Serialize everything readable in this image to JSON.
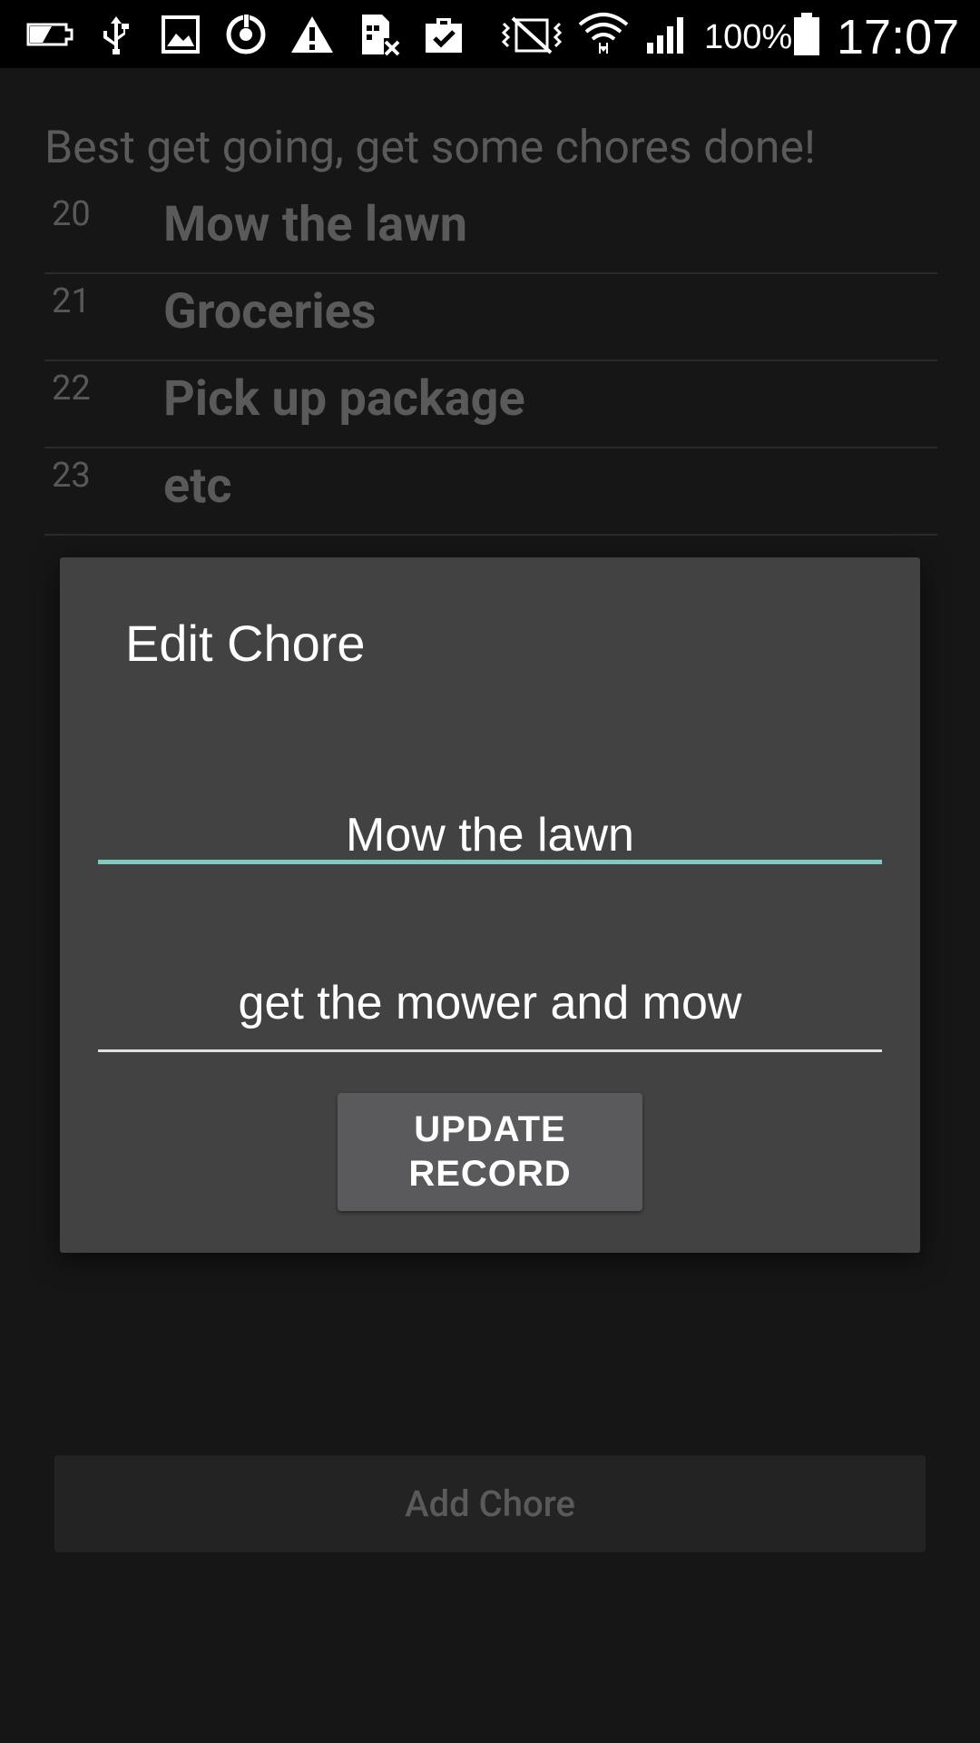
{
  "status_bar": {
    "icons": [
      "battery-low-icon",
      "usb-icon",
      "image-icon",
      "sync-icon",
      "warning-icon",
      "sim-error-icon",
      "clipboard-check-icon",
      "vibrate-icon",
      "wifi-icon",
      "signal-icon",
      "battery-icon"
    ],
    "battery_percent": "100%",
    "time": "17:07"
  },
  "main": {
    "heading": "Best get going, get some chores done!",
    "chores": [
      {
        "id": "20",
        "title": "Mow the lawn"
      },
      {
        "id": "21",
        "title": "Groceries"
      },
      {
        "id": "22",
        "title": "Pick up package"
      },
      {
        "id": "23",
        "title": "etc"
      }
    ],
    "add_button_label": "Add Chore"
  },
  "dialog": {
    "title": "Edit Chore",
    "title_field_value": "Mow the lawn",
    "description_field_value": "get the mower and mow",
    "update_button_label": "UPDATE RECORD"
  },
  "colors": {
    "accent": "#7fcbc4",
    "dialog_bg": "#424242",
    "screen_bg": "#161616"
  }
}
